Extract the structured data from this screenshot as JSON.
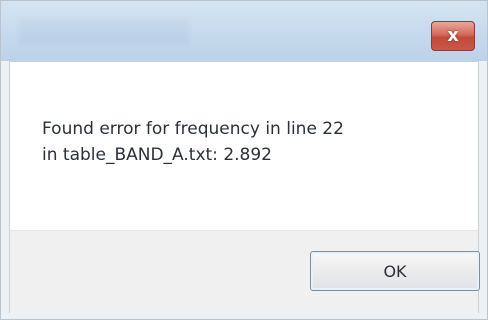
{
  "window": {
    "close_symbol": "x"
  },
  "dialog": {
    "message": "Found error for frequency in line 22\nin table_BAND_A.txt: 2.892",
    "ok_label": "OK"
  },
  "colors": {
    "titlebar": "#c8dbee",
    "close_button": "#c44a3a",
    "button_area": "#f0f0f0",
    "text": "#2a2f38"
  }
}
